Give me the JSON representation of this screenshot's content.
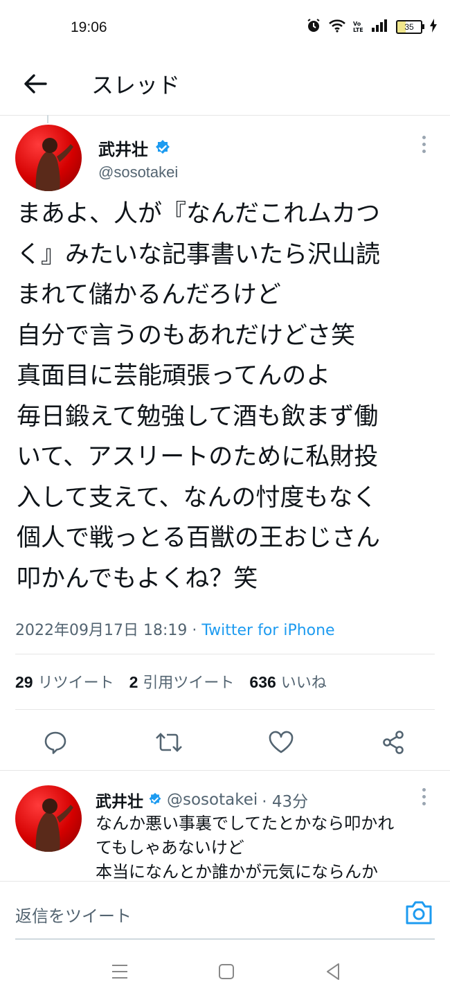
{
  "status": {
    "time": "19:06",
    "battery": "35",
    "network": "VoLTE"
  },
  "header": {
    "title": "スレッド"
  },
  "tweet": {
    "name": "武井壮",
    "handle": "@sosotakei",
    "body": [
      "まあよ、人が『なんだこれムカつ",
      "く』みたいな記事書いたら沢山読",
      "まれて儲かるんだろけど",
      "自分で言うのもあれだけどさ笑",
      "真面目に芸能頑張ってんのよ",
      "毎日鍛えて勉強して酒も飲まず働",
      "いて、アスリートのために私財投",
      "入して支えて、なんの忖度もなく",
      "個人で戦っとる百獣の王おじさん",
      "叩かんでもよくね？笑"
    ],
    "timestamp": "2022年09月17日 18:19 · ",
    "source": "Twitter for iPhone",
    "stats": {
      "retweets": "29",
      "retweets_label": "リツイート",
      "quotes": "2",
      "quotes_label": "引用ツイート",
      "likes": "636",
      "likes_label": "いいね"
    }
  },
  "reply": {
    "name": "武井壮",
    "handle": "@sosotakei",
    "time": "· 43分",
    "body": [
      "なんか悪い事裏でしてたとかなら叩かれ",
      "てもしゃあないけど",
      "本当になんとか誰かが元気にならんか"
    ]
  },
  "reply_bar": {
    "placeholder": "返信をツイート"
  },
  "icons": {
    "back": "arrow-left-icon",
    "verified": "verified-badge-icon",
    "more": "more-vertical-icon",
    "reply": "reply-icon",
    "retweet": "retweet-icon",
    "like": "heart-icon",
    "share": "share-icon",
    "camera": "camera-icon",
    "alarm": "alarm-icon",
    "wifi": "wifi-icon",
    "signal": "signal-icon"
  },
  "colors": {
    "accent": "#1d9bf0",
    "text": "#0f1419",
    "secondary": "#536471",
    "avatar_bg": "#d40000"
  }
}
